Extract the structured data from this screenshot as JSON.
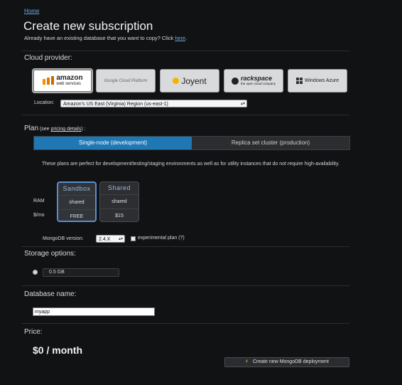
{
  "breadcrumb": {
    "home": "Home"
  },
  "page": {
    "title": "Create new subscription",
    "copy_prompt": "Already have an existing database that you want to copy? Click ",
    "copy_link": "here",
    "copy_end": "."
  },
  "cloud": {
    "heading": "Cloud provider:",
    "providers": [
      {
        "name": "amazon",
        "sub": "web services"
      },
      {
        "name": "Google Cloud Platform",
        "sub": ""
      },
      {
        "name": "Joyent",
        "sub": ""
      },
      {
        "name": "rackspace",
        "sub": "the open cloud company"
      },
      {
        "name": "Windows Azure",
        "sub": ""
      }
    ],
    "location_label": "Location:",
    "location_value": "Amazon's US East (Virginia) Region (us-east-1)"
  },
  "plan": {
    "heading": "Plan",
    "see_prefix": " (see ",
    "pricing_link": "pricing details",
    "see_suffix": ") :",
    "tab_dev": "Single-node (development)",
    "tab_prod": "Replica set cluster (production)",
    "description": "These plans are perfect for development/testing/staging environments as well as for utility instances that do not require high-availability.",
    "ram_label": "RAM",
    "price_label": "$/mo",
    "cards": [
      {
        "title": "Sandbox",
        "ram": "shared",
        "price": "FREE"
      },
      {
        "title": "Shared",
        "ram": "shared",
        "price": "$15"
      }
    ],
    "version_label": "MongoDB version:",
    "version_value": "2.4.X",
    "experimental_label": "experimental plan (?)"
  },
  "storage": {
    "heading": "Storage options:",
    "option": "0.5 GB"
  },
  "database": {
    "heading": "Database name:",
    "value": "myapp"
  },
  "price": {
    "heading": "Price:",
    "value": "$0 / month"
  },
  "deploy": {
    "label": "Create new MongoDB deployment"
  }
}
